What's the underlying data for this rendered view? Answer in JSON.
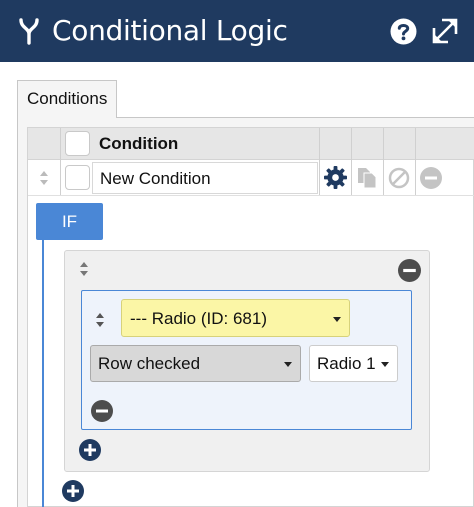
{
  "header": {
    "title": "Conditional Logic",
    "icons": {
      "logo": "branch-icon",
      "help": "help-circle-icon",
      "expand": "expand-arrows-icon"
    }
  },
  "tabs": [
    {
      "label": "Conditions"
    }
  ],
  "conditions_table": {
    "column_header": "Condition",
    "rows": [
      {
        "name": "New Condition"
      }
    ],
    "row_icons": [
      "gear-icon",
      "copy-icon",
      "disable-icon",
      "remove-icon"
    ]
  },
  "logic": {
    "if_label": "IF",
    "condition": {
      "field": "--- Radio (ID: 681)",
      "operator": "Row checked",
      "value": "Radio 1"
    }
  },
  "colors": {
    "header_bg": "#1f3a60",
    "accent_blue": "#4a87d6",
    "field_select_bg": "#fbf6a6",
    "dark_icon": "#1f3a60"
  }
}
